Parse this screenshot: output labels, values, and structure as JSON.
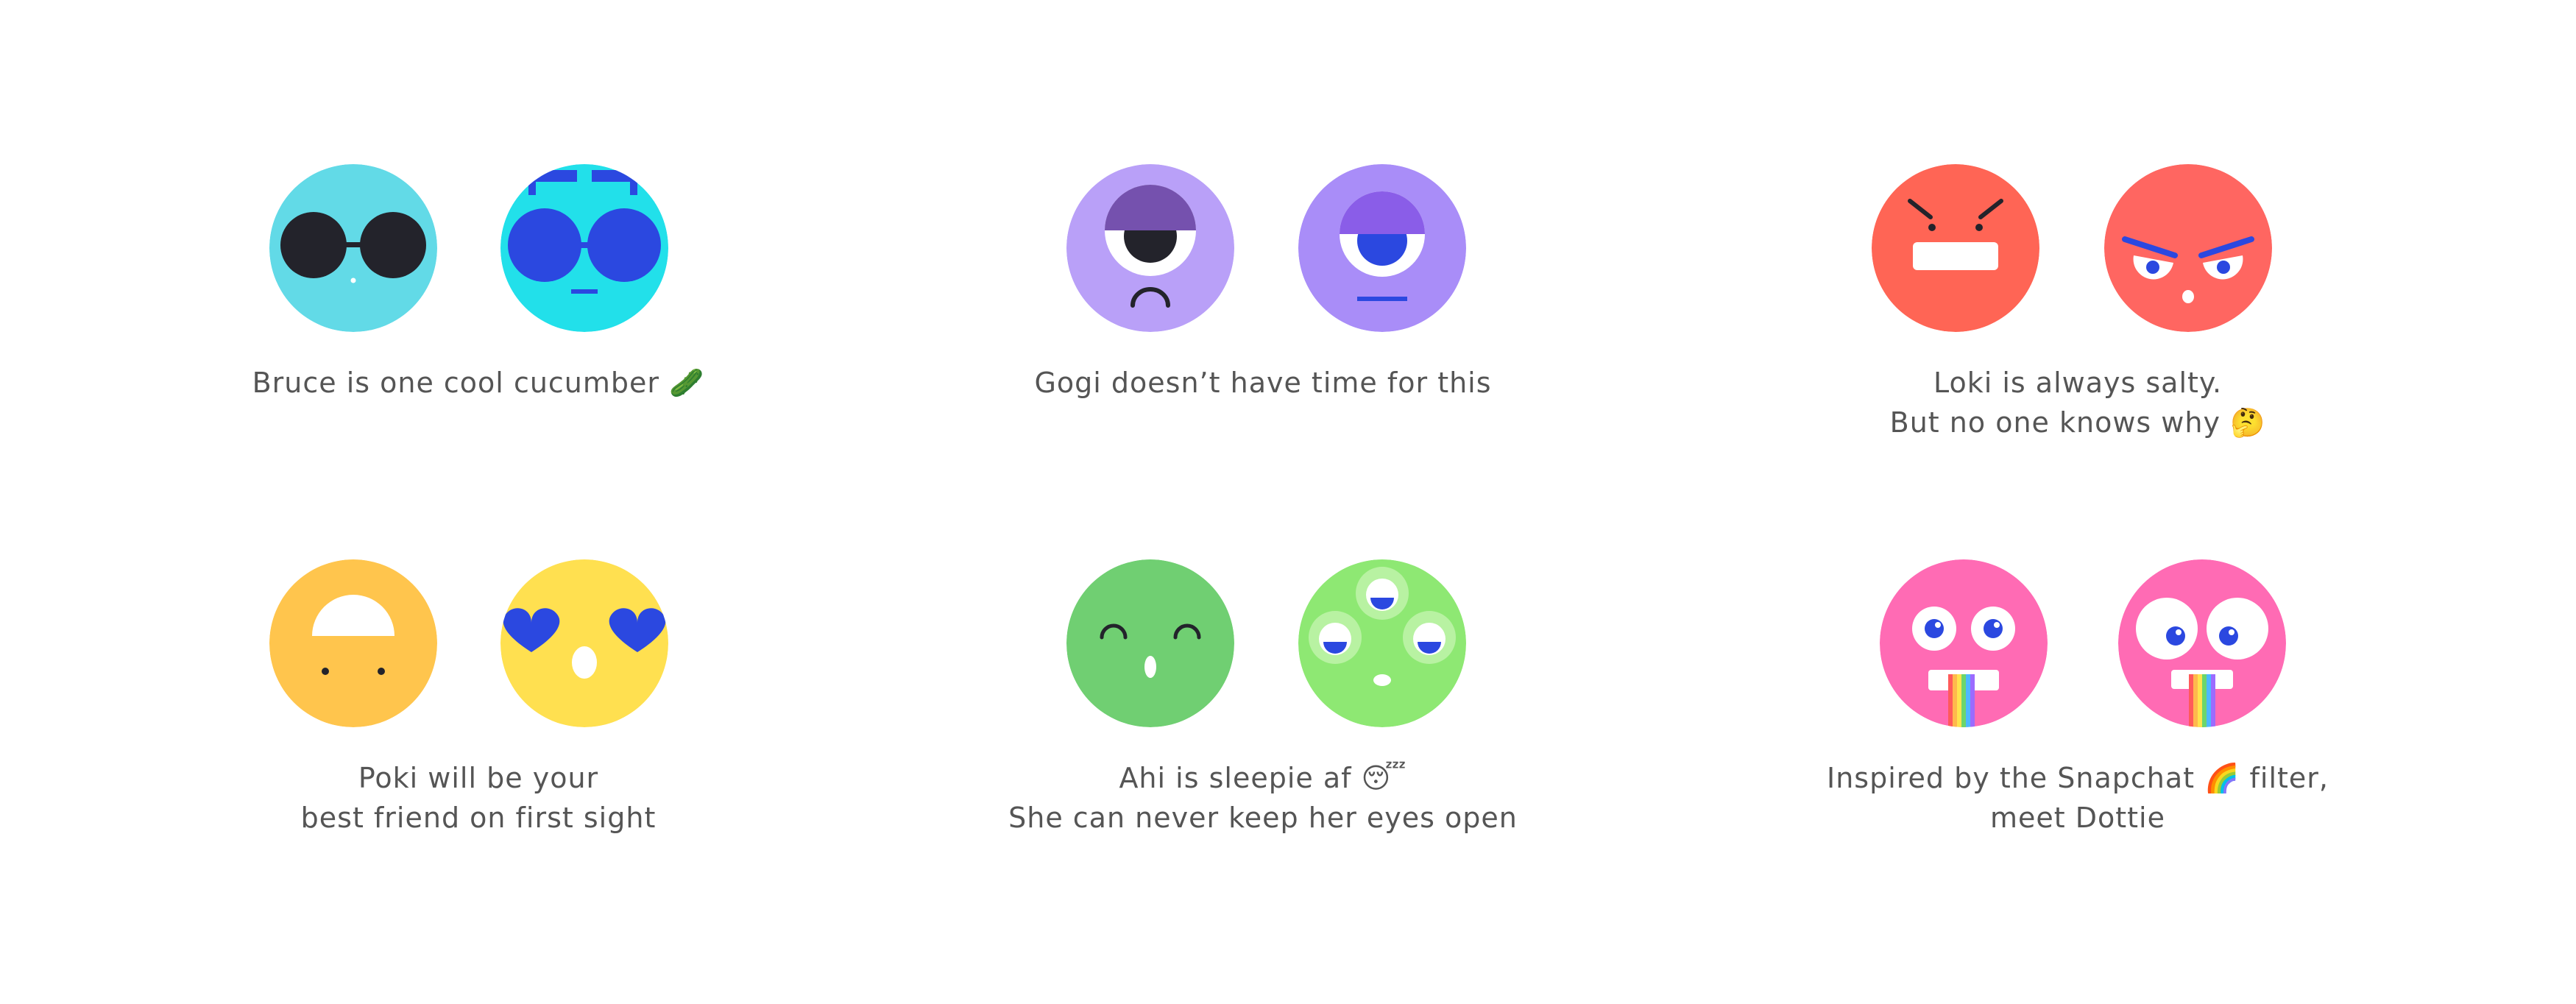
{
  "characters": [
    {
      "id": "bruce",
      "caption": [
        "Bruce is one cool cucumber 🥒"
      ],
      "colors": {
        "face_a": "#62DAE7",
        "face_b": "#22E0EA",
        "shades_a": "#23232B",
        "shades_b": "#2B48E0"
      }
    },
    {
      "id": "gogi",
      "caption": [
        "Gogi doesn’t have time for this"
      ],
      "colors": {
        "face_a": "#B9A0F8",
        "face_b": "#A98DF8",
        "lid_a": "#7551AE",
        "lid_b": "#8A5DE8",
        "iris_b": "#2B48E0"
      }
    },
    {
      "id": "loki",
      "caption": [
        "Loki is always salty.",
        "But no one knows why 🤔"
      ],
      "colors": {
        "face_a": "#FF6555",
        "face_b": "#FF6661",
        "brow_b": "#2B48E0"
      }
    },
    {
      "id": "poki",
      "caption": [
        "Poki will be your",
        "best friend on first sight"
      ],
      "colors": {
        "face_a": "#FFC54D",
        "face_b": "#FFE050",
        "heart_b": "#2B48E0"
      }
    },
    {
      "id": "ahi",
      "caption": [
        "Ahi is sleepie af 😴",
        "She can never keep her eyes open"
      ],
      "colors": {
        "face_a": "#70CF72",
        "face_b": "#8EE873",
        "eye_b": "#2B48E0"
      }
    },
    {
      "id": "dottie",
      "caption": [
        "Inspired by the Snapchat 🌈 filter,",
        "meet Dottie"
      ],
      "colors": {
        "face_a": "#FF6BB4",
        "face_b": "#FF6BB4",
        "pupil": "#2B48E0",
        "rainbow": [
          "#FF5A5A",
          "#FFB84D",
          "#FFE44D",
          "#6BD66B",
          "#4DB8FF",
          "#9B6BFF"
        ]
      }
    }
  ]
}
